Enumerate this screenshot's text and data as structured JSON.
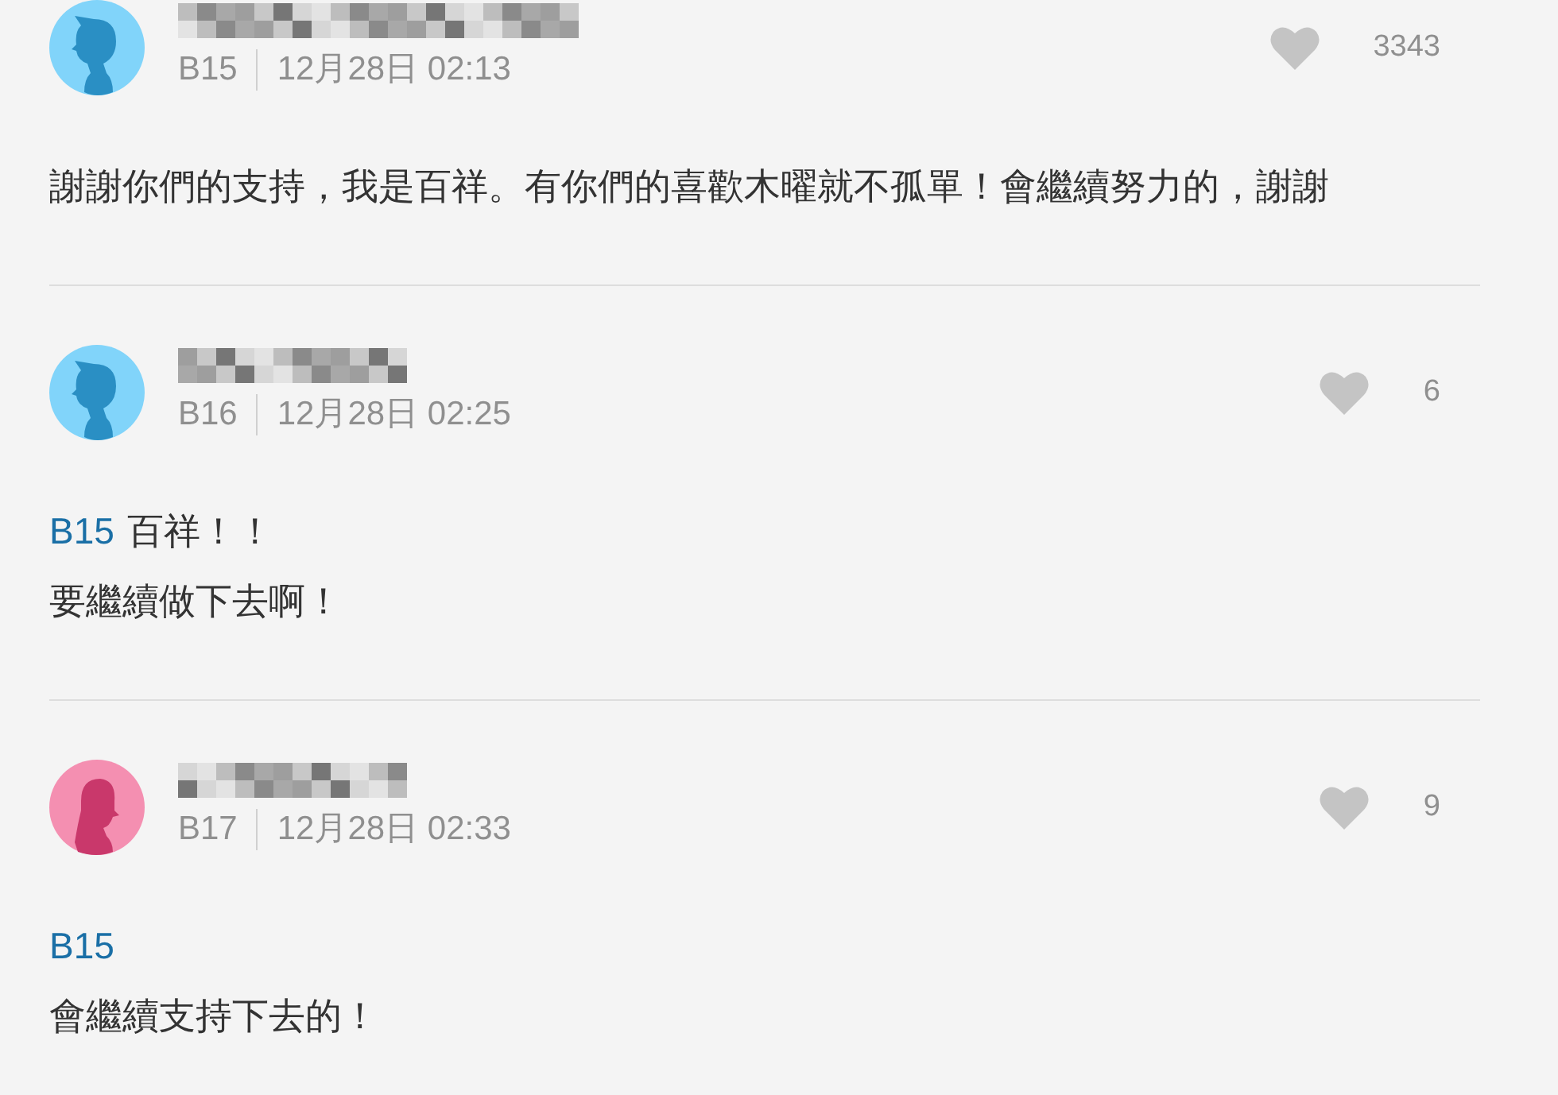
{
  "comments": [
    {
      "avatar": {
        "kind": "male"
      },
      "floor": "B15",
      "time": "12月28日 02:13",
      "likes": "3343",
      "paragraphs": [
        {
          "text": "謝謝你們的支持，我是百祥。有你們的喜歡木曜就不孤單！會繼續努力的，謝謝"
        }
      ]
    },
    {
      "avatar": {
        "kind": "male"
      },
      "floor": "B16",
      "time": "12月28日 02:25",
      "likes": "6",
      "paragraphs": [
        {
          "reply_to": "B15",
          "text": "百祥！！"
        },
        {
          "text": "要繼續做下去啊！"
        }
      ]
    },
    {
      "avatar": {
        "kind": "female"
      },
      "floor": "B17",
      "time": "12月28日 02:33",
      "likes": "9",
      "paragraphs": [
        {
          "reply_to": "B15"
        },
        {
          "text": "會繼續支持下去的！"
        }
      ]
    }
  ]
}
